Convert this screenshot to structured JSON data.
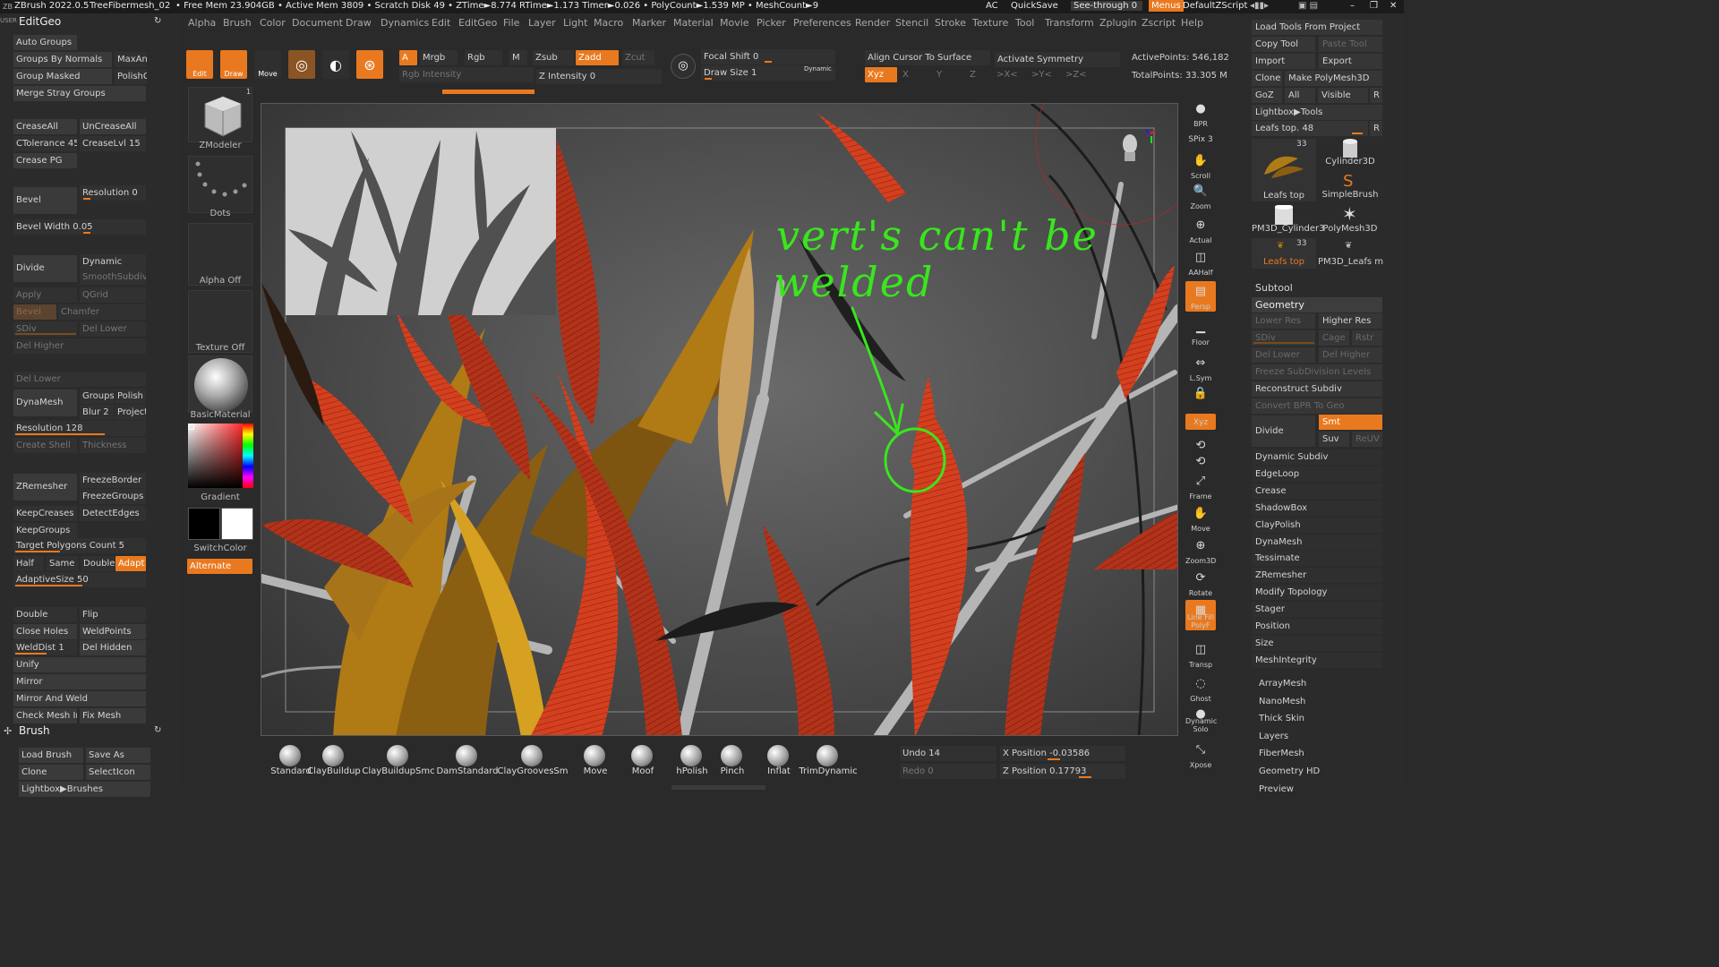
{
  "titlebar": {
    "app": "ZBrush 2022.0.5",
    "doc": "TreeFibermesh_02",
    "stats": "• Free Mem 23.904GB • Active Mem 3809 • Scratch Disk 49 • ZTime►8.774 RTime►1.173 Timer►0.026 • PolyCount►1.539 MP • MeshCount►9",
    "ac": "AC",
    "quicksave": "QuickSave",
    "seethrough": "See-through  0",
    "menus": "Menus",
    "script": "DefaultZScript"
  },
  "menus": [
    "Alpha",
    "Brush",
    "Color",
    "Document",
    "Draw",
    "Dynamics",
    "Edit",
    "EditGeo",
    "File",
    "Layer",
    "Light",
    "Macro",
    "Marker",
    "Material",
    "Movie",
    "Picker",
    "Preferences",
    "Render",
    "Stencil",
    "Stroke",
    "Texture",
    "Tool",
    "Transform",
    "Zplugin",
    "Zscript",
    "Help"
  ],
  "left": {
    "user": "USER",
    "title": "EditGeo",
    "auto_groups": "Auto Groups",
    "groups_by_normals": "Groups By Normals",
    "maxang": "MaxAn",
    "groups_masked": "Group Masked",
    "polishg": "PolishG",
    "merge_stray": "Merge Stray Groups",
    "crease_all": "CreaseAll",
    "uncrease_all": "UnCreaseAll",
    "ctolerance": "CTolerance 45",
    "crease_lvl": "CreaseLvl 15",
    "crease_pg": "Crease PG",
    "bevel": "Bevel",
    "resolution0": "Resolution 0",
    "bevel_width": "Bevel Width 0.05",
    "divide": "Divide",
    "dynamic": "Dynamic",
    "smooth_subdiv": "SmoothSubdiv",
    "apply": "Apply",
    "qgrid": "QGrid",
    "bevel2": "Bevel",
    "chamfer": "Chamfer",
    "sdiv": "SDiv",
    "del_lower": "Del Lower",
    "del_higher": "Del Higher",
    "del_lower2": "Del Lower",
    "dynamesh": "DynaMesh",
    "groups": "Groups",
    "polish": "Polish",
    "blur": "Blur 2",
    "project": "Project",
    "resolution128": "Resolution 128",
    "create_shell": "Create Shell",
    "thickness": "Thickness",
    "zremesher": "ZRemesher",
    "freeze_border": "FreezeBorder",
    "freeze_groups": "FreezeGroups",
    "keep_creases": "KeepCreases",
    "detect_edges": "DetectEdges",
    "keep_groups": "KeepGroups",
    "target_polys": "Target Polygons Count 5",
    "half": "Half",
    "same": "Same",
    "double": "Double",
    "adapt": "Adapt",
    "adaptive_size": "AdaptiveSize 50",
    "double2": "Double",
    "flip": "Flip",
    "close_holes": "Close Holes",
    "weld_points": "WeldPoints",
    "weld_dist": "WeldDist 1",
    "del_hidden": "Del Hidden",
    "unify": "Unify",
    "mirror": "Mirror",
    "mirror_weld": "Mirror And Weld",
    "check_mesh": "Check Mesh Int",
    "fix_mesh": "Fix Mesh",
    "brush_title": "Brush",
    "load_brush": "Load Brush",
    "save_as": "Save As",
    "clone": "Clone",
    "select_icon": "SelectIcon",
    "lightbox_brushes": "Lightbox▶Brushes"
  },
  "matcol": {
    "zmodeler": "ZModeler",
    "dots": "Dots",
    "alpha_off": "Alpha Off",
    "texture_off": "Texture Off",
    "material": "BasicMaterial",
    "gradient": "Gradient",
    "switch_color": "SwitchColor",
    "alternate": "Alternate",
    "count1": "1"
  },
  "topbar": {
    "edit": "Edit",
    "draw": "Draw",
    "move": "Move",
    "scale": "Scale",
    "rotate": "Rotate",
    "a": "A",
    "mrgb": "Mrgb",
    "rgb": "Rgb",
    "m": "M",
    "zsub": "Zsub",
    "zadd": "Zadd",
    "zcut": "Zcut",
    "rgb_intensity": "Rgb Intensity",
    "z_intensity": "Z Intensity 0",
    "focal_shift": "Focal Shift 0",
    "draw_size": "Draw Size 1",
    "dynamic": "Dynamic",
    "align_cursor": "Align Cursor To Surface",
    "activate_sym": "Activate Symmetry",
    "xyz": "Xyz",
    "x": "X",
    "y": "Y",
    "z": "Z",
    "rx": ">X<",
    "ry": ">Y<",
    "rz": ">Z<",
    "active_points": "ActivePoints: 546,182",
    "total_points": "TotalPoints: 33.305 M"
  },
  "viewport": {
    "annotation_line1": "vert's can't be",
    "annotation_line2": "welded"
  },
  "rtool": [
    "BPR",
    "SPix 3",
    "Scroll",
    "Zoom",
    "Actual",
    "AAHalf",
    "Persp",
    "Floor",
    "L.Sym",
    "",
    "Xyz",
    "",
    "",
    "Frame",
    "Move",
    "Zoom3D",
    "Rotate",
    "Line Fill PolyF",
    "Transp",
    "Ghost",
    "Dynamic Solo",
    "Xpose"
  ],
  "right": {
    "load_tools": "Load Tools From Project",
    "copy_tool": "Copy Tool",
    "paste_tool": "Paste Tool",
    "import": "Import",
    "export": "Export",
    "clone": "Clone",
    "make_polymesh": "Make PolyMesh3D",
    "goz": "GoZ",
    "all": "All",
    "visible": "Visible",
    "r": "R",
    "lightbox_tools": "Lightbox▶Tools",
    "leafs_top": "Leafs top. 48",
    "r2": "R",
    "tools": [
      {
        "name": "Leafs top",
        "count": "33"
      },
      {
        "name": "Cylinder3D",
        "count": ""
      },
      {
        "name": "SimpleBrush",
        "count": ""
      },
      {
        "name": "PM3D_Cylinder3",
        "count": ""
      },
      {
        "name": "PolyMesh3D",
        "count": ""
      },
      {
        "name": "Leafs top",
        "count": "33"
      },
      {
        "name": "PM3D_Leafs m",
        "count": ""
      }
    ],
    "subtool": "Subtool",
    "geometry": "Geometry",
    "lower_res": "Lower Res",
    "higher_res": "Higher Res",
    "sdiv": "SDiv",
    "cage": "Cage",
    "rstr": "Rstr",
    "del_lower": "Del Lower",
    "del_higher": "Del Higher",
    "freeze_subdiv": "Freeze SubDivision Levels",
    "reconstruct": "Reconstruct Subdiv",
    "convert_bpr": "Convert BPR To Geo",
    "divide": "Divide",
    "smt": "Smt",
    "suv": "Suv",
    "reuv": "ReUV",
    "sections": [
      "Dynamic Subdiv",
      "EdgeLoop",
      "Crease",
      "ShadowBox",
      "ClayPolish",
      "DynaMesh",
      "Tessimate",
      "ZRemesher",
      "Modify Topology",
      "Stager",
      "Position",
      "Size",
      "MeshIntegrity"
    ],
    "sections2": [
      "ArrayMesh",
      "NanoMesh",
      "Thick Skin",
      "Layers",
      "FiberMesh",
      "Geometry HD",
      "Preview"
    ]
  },
  "brushes": [
    "Standard",
    "ClayBuildup",
    "ClayBuildupSmc",
    "DamStandard",
    "ClayGroovesSm",
    "Move",
    "Moof",
    "hPolish",
    "Pinch",
    "Inflat",
    "TrimDynamic"
  ],
  "status": {
    "undo": "Undo 14",
    "redo": "Redo 0",
    "xpos": "X Position -0.03586",
    "zpos": "Z Position 0.17793"
  },
  "colors": {
    "accent": "#e9791f",
    "annotation": "#39e61d",
    "leaf": "#d03a1e"
  }
}
